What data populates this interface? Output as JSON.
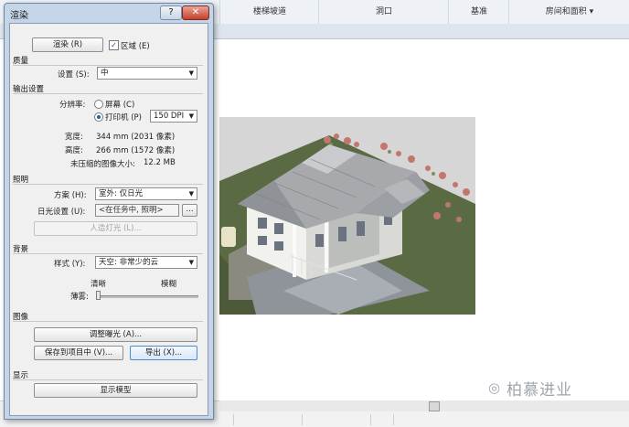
{
  "app": {
    "ribbon_tabs": [
      "楼梯坡道",
      "洞口",
      "基准",
      "房间和面积 ▾"
    ],
    "watermark": "柏慕进业",
    "watermark_icon": "wechat-logo-icon"
  },
  "dialog": {
    "title": "渲染",
    "help_glyph": "?",
    "close_glyph": "✕",
    "render_button": "渲染 (R)",
    "region_checkbox_label": "区域 (E)",
    "region_checked": true,
    "quality": {
      "section": "质量",
      "setting_label": "设置 (S):",
      "setting_value": "中"
    },
    "output": {
      "section": "输出设置",
      "resolution_label": "分辨率:",
      "screen_option": "屏幕 (C)",
      "printer_option": "打印机 (P)",
      "selected_option": "printer",
      "dpi_value": "150 DPI",
      "width_label": "宽度:",
      "width_value": "344 mm (2031 像素)",
      "height_label": "高度:",
      "height_value": "266 mm (1572 像素)",
      "size_label": "未压缩的图像大小:",
      "size_value": "12.2 MB"
    },
    "lighting": {
      "section": "照明",
      "scheme_label": "方案 (H):",
      "scheme_value": "室外: 仅日光",
      "sun_label": "日光设置 (U):",
      "sun_value": "<在任务中, 照明>",
      "sun_browse": "...",
      "artificial_button": "人造灯光 (L)..."
    },
    "background": {
      "section": "背景",
      "style_label": "样式 (Y):",
      "style_value": "天空: 非常少的云",
      "clear_label": "清晰",
      "hazy_label": "模糊",
      "haze_label": "薄雾:",
      "haze_level": 0.0
    },
    "image": {
      "section": "图像",
      "adjust_exposure_button": "调整曝光 (A)...",
      "save_to_project_button": "保存到项目中 (V)...",
      "export_button": "导出 (X)..."
    },
    "display": {
      "section": "显示",
      "show_model_button": "显示模型"
    }
  },
  "colors": {
    "dialog_frame": "#c4d5e8",
    "dialog_client": "#f0f0f0",
    "close_button": "#c5402c",
    "render_background": "#d6d6d6",
    "grass": "#5a6a43"
  }
}
